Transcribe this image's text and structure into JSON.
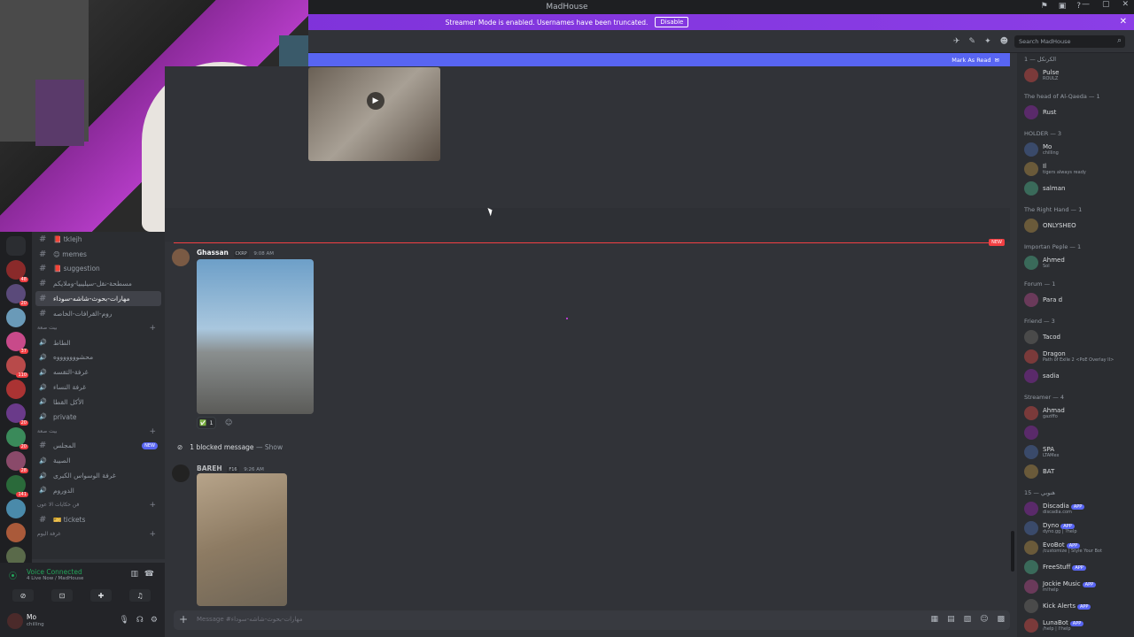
{
  "window": {
    "title": "MadHouse"
  },
  "streamer_banner": {
    "text": "Streamer Mode is enabled. Usernames have been truncated.",
    "disable_label": "Disable"
  },
  "search": {
    "placeholder": "Search MadHouse"
  },
  "unread_bar": {
    "label": "Mark As Read"
  },
  "servers": [
    {
      "badge": ""
    },
    {
      "badge": "48"
    },
    {
      "badge": "20"
    },
    {
      "badge": ""
    },
    {
      "badge": "37"
    },
    {
      "badge": "110"
    },
    {
      "badge": ""
    },
    {
      "badge": "20"
    },
    {
      "badge": "20"
    },
    {
      "badge": "28"
    },
    {
      "badge": "141"
    },
    {
      "badge": ""
    },
    {
      "badge": ""
    },
    {
      "badge": "NEW"
    }
  ],
  "channels": [
    {
      "type": "text",
      "label": "📕 tklejh"
    },
    {
      "type": "text",
      "label": "😊 memes"
    },
    {
      "type": "text",
      "label": "📕 suggestion"
    },
    {
      "type": "text",
      "label": "مسطحة-نقل-سيليبيا-وملايكم"
    },
    {
      "type": "text",
      "label": "مهارات-بحوث-شاشه-سوداء",
      "active": true
    },
    {
      "type": "text",
      "label": "روم-القرافات-الخاصه"
    },
    {
      "type": "category",
      "label": "بيت صعة"
    },
    {
      "type": "voice",
      "label": "الطاط"
    },
    {
      "type": "voice",
      "label": "محشوووووووه"
    },
    {
      "type": "voice",
      "label": "غرفة-التقسه"
    },
    {
      "type": "voice",
      "label": "غرفة النساء"
    },
    {
      "type": "voice",
      "label": "الأكل القطا"
    },
    {
      "type": "voice",
      "label": "private"
    },
    {
      "type": "category",
      "label": "بيت صعة"
    },
    {
      "type": "text",
      "label": "المجلس",
      "badge": "NEW"
    },
    {
      "type": "voice",
      "label": "الصيبة"
    },
    {
      "type": "voice",
      "label": "غرفة الوسواس الكبرى"
    },
    {
      "type": "voice",
      "label": "الدوروم"
    },
    {
      "type": "category",
      "label": "فن حكايات الا عون"
    },
    {
      "type": "text",
      "label": "🎫 tickets"
    },
    {
      "type": "category",
      "label": "غرفة اليوم"
    }
  ],
  "voice": {
    "status": "Voice Connected",
    "channel": "4 Live Now / MadHouse"
  },
  "user": {
    "name": "Mo",
    "status": "chilling"
  },
  "messages": [
    {
      "author": "Ghassan",
      "role": "CKRP",
      "time": "9:08 AM"
    },
    {
      "blocked_text": "1 blocked message",
      "show_label": "— Show"
    },
    {
      "author": "BAREH",
      "role": "F16",
      "time": "9:26 AM"
    }
  ],
  "reaction": {
    "emoji": "✅",
    "count": "1"
  },
  "new_divider": "NEW",
  "composer": {
    "placeholder": "Message #مهارات-بحوث-شاشه-سوداء"
  },
  "members": {
    "groups": [
      {
        "title": "1 — الكرنكل",
        "members": [
          {
            "name": "Pulse",
            "sub": "ROULZ"
          }
        ]
      },
      {
        "title": "The head of Al-Qaeda — 1",
        "members": [
          {
            "name": "Rust",
            "sub": ""
          }
        ]
      },
      {
        "title": "HOLDER — 3",
        "members": [
          {
            "name": "Mo",
            "sub": "chilling"
          },
          {
            "name": "Il",
            "sub": "tigers always ready"
          },
          {
            "name": "salman",
            "sub": ""
          }
        ]
      },
      {
        "title": "The Right Hand — 1",
        "members": [
          {
            "name": "ONLYSHEO",
            "sub": ""
          }
        ]
      },
      {
        "title": "Importan Peple — 1",
        "members": [
          {
            "name": "Ahmed",
            "sub": "Sol"
          }
        ]
      },
      {
        "title": "Forum — 1",
        "members": [
          {
            "name": "Para d",
            "sub": ""
          }
        ]
      },
      {
        "title": "Friend — 3",
        "members": [
          {
            "name": "Tacod",
            "sub": ""
          },
          {
            "name": "Dragon",
            "sub": "Path of Exile 2 <PoE Overlay II>"
          },
          {
            "name": "sadia",
            "sub": ""
          }
        ]
      },
      {
        "title": "Streamer — 4",
        "members": [
          {
            "name": "Ahmad",
            "sub": "gaziffo"
          },
          {
            "name": "",
            "sub": ""
          },
          {
            "name": "SPA",
            "sub": "LTAMex"
          },
          {
            "name": "BAT",
            "sub": ""
          }
        ]
      },
      {
        "title": "15 — هنوبي",
        "members": [
          {
            "name": "Discadia",
            "sub": "discadia.com",
            "app": "APP"
          },
          {
            "name": "Dyno",
            "sub": "dyno.gg | ?help",
            "app": "APP"
          },
          {
            "name": "EvoBot",
            "sub": "/customize | Style Your Bot",
            "app": "APP"
          },
          {
            "name": "FreeStuff",
            "sub": "",
            "app": "APP"
          },
          {
            "name": "Jockie Music",
            "sub": "m!help",
            "app": "APP"
          },
          {
            "name": "Kick Alerts",
            "sub": "",
            "app": "APP"
          },
          {
            "name": "LunaBot",
            "sub": "/help | l!help",
            "app": "APP"
          }
        ]
      }
    ]
  },
  "colors": {
    "banner": "#8b3ee6",
    "accent": "#5865f2",
    "online": "#23a55a",
    "danger": "#f23f43"
  }
}
